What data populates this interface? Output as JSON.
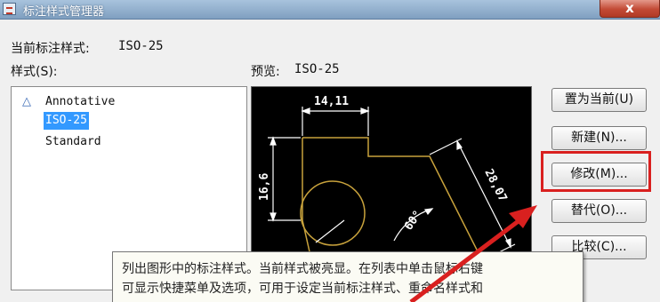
{
  "window": {
    "title": "标注样式管理器",
    "close_label": "x"
  },
  "current_style": {
    "label": "当前标注样式:",
    "value": "ISO-25"
  },
  "styles_panel": {
    "label": "样式(S):",
    "items": [
      "Annotative",
      "ISO-25",
      "Standard"
    ],
    "selected": "ISO-25"
  },
  "preview": {
    "label": "预览:",
    "style_name": "ISO-25",
    "dim_top": "14,11",
    "dim_left": "16,6",
    "dim_slant": "28,07",
    "dim_angle": "60°"
  },
  "buttons": {
    "set_current": "置为当前(U)",
    "new": "新建(N)...",
    "modify": "修改(M)...",
    "override": "替代(O)...",
    "compare": "比较(C)..."
  },
  "tooltip": {
    "line1": "列出图形中的标注样式。当前样式被亮显。在列表中单击鼠标右键",
    "line2": "可显示快捷菜单及选项，可用于设定当前标注样式、重命名样式和"
  },
  "colors": {
    "geometry": "#c8a23c",
    "dimensions": "#ffffff",
    "annotation_red": "#d9201f",
    "selection": "#3399ff"
  }
}
